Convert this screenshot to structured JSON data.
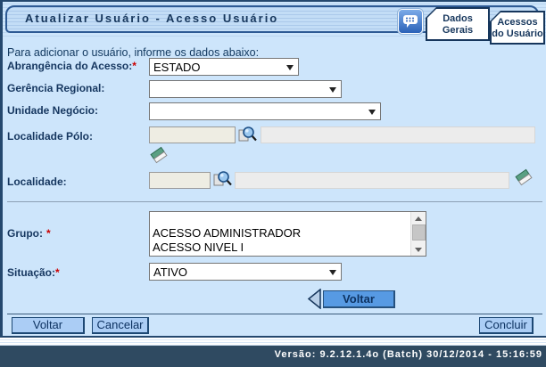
{
  "header": {
    "title": "Atualizar Usuário - Acesso Usuário",
    "help_icon": "chat-bubble-icon",
    "tabs": [
      {
        "label": "Dados Gerais",
        "line1": "Dados",
        "line2": "Gerais",
        "active": true
      },
      {
        "label": "Acessos do Usuário",
        "line1": "Acessos",
        "line2": "do Usuário",
        "active": false
      }
    ]
  },
  "intro": {
    "text": "Para adicionar o usuário, informe os dados abaixo:"
  },
  "form": {
    "required_marker": "*",
    "abrangencia": {
      "label": "Abrangência do Acesso:",
      "required": true,
      "value": "ESTADO"
    },
    "gerencia": {
      "label": "Gerência Regional:",
      "required": false,
      "value": ""
    },
    "unidade": {
      "label": "Unidade Negócio:",
      "required": false,
      "value": ""
    },
    "localidade_polo": {
      "label": "Localidade Pólo:",
      "code_value": "",
      "name_value": ""
    },
    "localidade": {
      "label": "Localidade:",
      "code_value": "",
      "name_value": ""
    },
    "grupo": {
      "label": "Grupo:",
      "required": true,
      "options": [
        "",
        "ACESSO ADMINISTRADOR",
        "ACESSO NIVEL I"
      ]
    },
    "situacao": {
      "label": "Situação:",
      "required": true,
      "value": "ATIVO"
    }
  },
  "icons": {
    "search": "magnifier-over-page-icon",
    "clear": "eraser-icon",
    "back_arrow": "left-arrow-icon",
    "dropdown": "chevron-down-icon"
  },
  "actions": {
    "voltar_mid": "Voltar",
    "voltar": "Voltar",
    "cancelar": "Cancelar",
    "concluir": "Concluir"
  },
  "footer": {
    "version_text": "Versão: 9.2.12.1.4o (Batch) 30/12/2014 - 15:16:59"
  },
  "colors": {
    "page_bg": "#cde5fb",
    "frame": "#24486e",
    "title_text": "#16365c",
    "required_red": "#cc0000",
    "button_blue": "#579ae3",
    "button_light_blue": "#abcdf5",
    "footer_bg": "#2f4a61",
    "disabled_field_bg": "#eeede3"
  }
}
